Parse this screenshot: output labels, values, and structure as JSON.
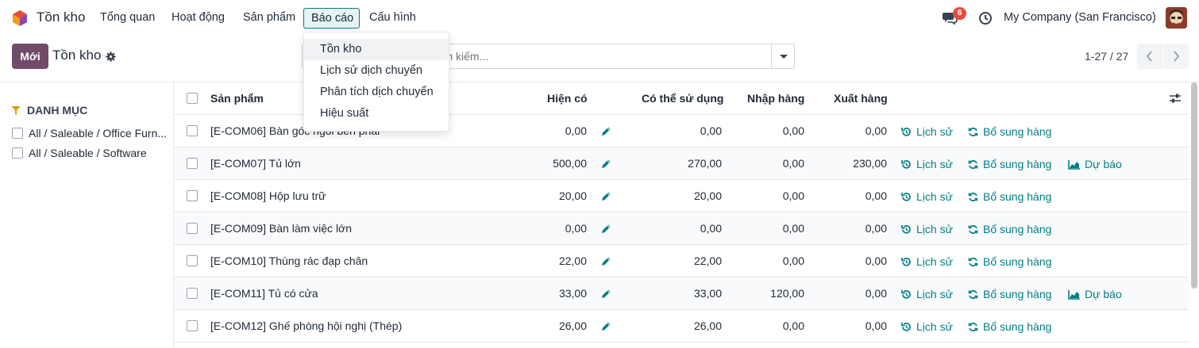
{
  "navbar": {
    "app_name": "Tồn kho",
    "menu": [
      "Tổng quan",
      "Hoạt động",
      "Sản phẩm",
      "Báo cáo",
      "Cấu hình"
    ],
    "active_menu": "Báo cáo",
    "chat_badge": "6",
    "company": "My Company (San Francisco)",
    "icons": {
      "logo": "inventory-logo-icon",
      "chat": "chat-icon",
      "activity": "clock-icon"
    }
  },
  "control_panel": {
    "new_button": "Mới",
    "breadcrumb": "Tồn kho",
    "search_placeholder": "Tìm kiếm...",
    "pager": "1-27 / 27"
  },
  "report_menu": {
    "items": [
      "Tồn kho",
      "Lịch sử dịch chuyển",
      "Phân tích dịch chuyển",
      "Hiệu suất"
    ],
    "highlighted": "Tồn kho"
  },
  "side_panel": {
    "title": "DANH MỤC",
    "items": [
      "All / Saleable / Office Furn...",
      "All / Saleable / Software"
    ]
  },
  "table": {
    "headers": {
      "product": "Sản phẩm",
      "on_hand": "Hiện có",
      "available": "Có thể sử dụng",
      "incoming": "Nhập hàng",
      "outgoing": "Xuất hàng"
    },
    "actions": {
      "history": "Lịch sử",
      "replenish": "Bổ sung hàng",
      "forecast": "Dự báo"
    },
    "rows": [
      {
        "product": "[E-COM06] Bàn góc ngồi bên phải",
        "on_hand": "0,00",
        "available": "0,00",
        "incoming": "0,00",
        "outgoing": "0,00",
        "forecast": false
      },
      {
        "product": "[E-COM07] Tủ lớn",
        "on_hand": "500,00",
        "available": "270,00",
        "incoming": "0,00",
        "outgoing": "230,00",
        "forecast": true
      },
      {
        "product": "[E-COM08] Hộp lưu trữ",
        "on_hand": "20,00",
        "available": "20,00",
        "incoming": "0,00",
        "outgoing": "0,00",
        "forecast": false
      },
      {
        "product": "[E-COM09] Bàn làm việc lớn",
        "on_hand": "0,00",
        "available": "0,00",
        "incoming": "0,00",
        "outgoing": "0,00",
        "forecast": false
      },
      {
        "product": "[E-COM10] Thùng rác đạp chân",
        "on_hand": "22,00",
        "available": "22,00",
        "incoming": "0,00",
        "outgoing": "0,00",
        "forecast": false
      },
      {
        "product": "[E-COM11] Tủ có cửa",
        "on_hand": "33,00",
        "available": "33,00",
        "incoming": "120,00",
        "outgoing": "0,00",
        "forecast": true
      },
      {
        "product": "[E-COM12] Ghế phòng hội nghị (Thép)",
        "on_hand": "26,00",
        "available": "26,00",
        "incoming": "0,00",
        "outgoing": "0,00",
        "forecast": false
      }
    ]
  }
}
